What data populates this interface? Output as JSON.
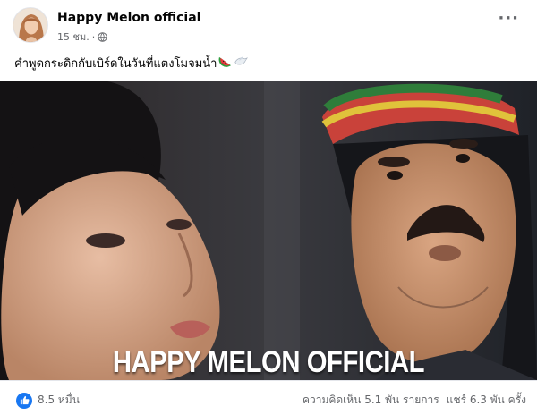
{
  "post": {
    "page_name": "Happy Melon official",
    "time": "15 ชม.",
    "separator": "·",
    "visibility_icon": "globe-icon",
    "more_icon": "more-options-icon",
    "more_symbol": "···",
    "caption_text": "คำพูดกระดิกกับเบิร์ดในวันที่แตงโมจมน้ำ",
    "caption_emojis": [
      "watermelon-emoji",
      "dove-emoji"
    ]
  },
  "media": {
    "watermark": "HAPPY MELON OFFICIAL"
  },
  "footer": {
    "reaction_icon": "like-icon",
    "reaction_count": "8.5 หมื่น",
    "comments": "ความคิดเห็น 5.1 พัน รายการ",
    "shares": "แชร์ 6.3 พัน ครั้ง"
  },
  "colors": {
    "accent": "#1877f2",
    "secondary_text": "#65676b",
    "primary_text": "#050505"
  }
}
